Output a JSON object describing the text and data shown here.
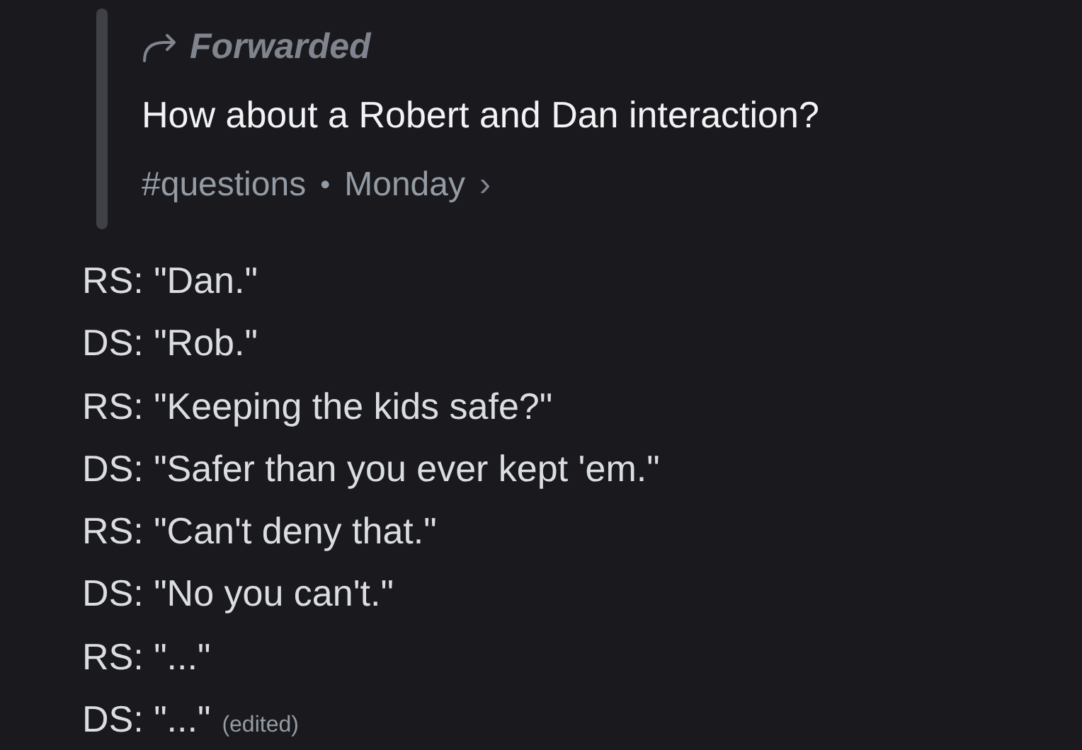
{
  "forward": {
    "label": "Forwarded",
    "text": "How about a Robert and Dan interaction?",
    "channel": "#questions",
    "separator": "•",
    "time": "Monday",
    "chevron": "›"
  },
  "lines": [
    {
      "text": "RS: \"Dan.\""
    },
    {
      "text": "DS: \"Rob.\""
    },
    {
      "text": "RS: \"Keeping the kids safe?\""
    },
    {
      "text": "DS: \"Safer than you ever kept 'em.\""
    },
    {
      "text": "RS: \"Can't deny that.\""
    },
    {
      "text": "DS: \"No you can't.\""
    },
    {
      "text": "RS: \"...\""
    },
    {
      "text": "DS: \"...\"",
      "edited_label": "(edited)"
    }
  ]
}
